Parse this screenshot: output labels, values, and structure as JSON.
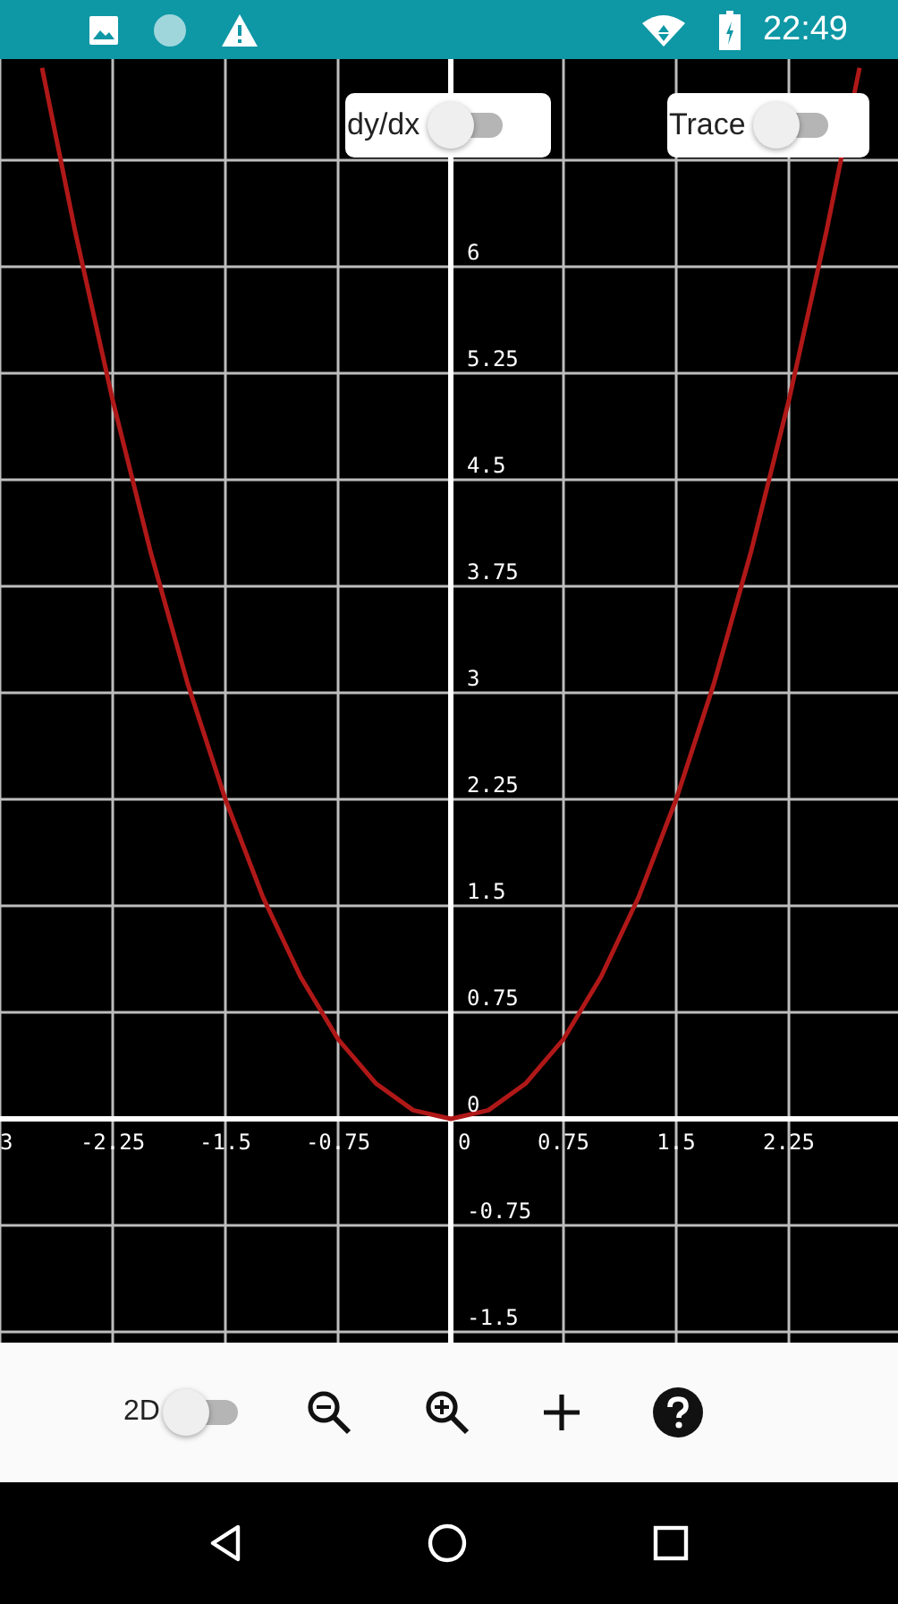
{
  "status_bar": {
    "time": "22:49"
  },
  "toggles": [
    {
      "label": "dy/dx",
      "on": false
    },
    {
      "label": "Trace",
      "on": false
    }
  ],
  "graph": {
    "chart_data": {
      "type": "line",
      "grid": true,
      "x": [
        -2.72,
        -2.5,
        -2.25,
        -2,
        -1.75,
        -1.5,
        -1.25,
        -1,
        -0.75,
        -0.5,
        -0.25,
        0,
        0.25,
        0.5,
        0.75,
        1,
        1.25,
        1.5,
        1.75,
        2,
        2.25,
        2.5,
        2.72
      ],
      "series": [
        {
          "color": "#b01818",
          "values": [
            7.4,
            6.25,
            5.06,
            4,
            3.06,
            2.25,
            1.56,
            1,
            0.56,
            0.25,
            0.06,
            0,
            0.06,
            0.25,
            0.56,
            1,
            1.56,
            2.25,
            3.06,
            4,
            5.06,
            6.25,
            7.4
          ]
        }
      ],
      "xlim": [
        -3.0,
        2.976
      ],
      "ylim": [
        -1.576,
        7.462
      ],
      "xticks": [
        {
          "value": -3,
          "label": "3"
        },
        -2.25,
        -1.5,
        -0.75,
        0,
        0.75,
        1.5,
        2.25
      ],
      "yticks": [
        -1.5,
        -0.75,
        0,
        0.75,
        1.5,
        2.25,
        3,
        3.75,
        4.5,
        5.25,
        6
      ]
    }
  },
  "toolbar": {
    "mode_toggle": {
      "label": "2D",
      "on": false
    }
  }
}
